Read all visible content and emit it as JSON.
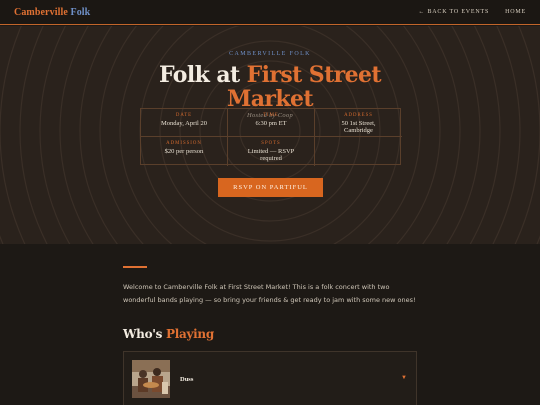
{
  "nav": {
    "brand_part1": "Camberville",
    "brand_part2": "Folk",
    "back_label": "← BACK TO EVENTS",
    "home_label": "HOME"
  },
  "hero": {
    "eyebrow": "CAMBERVILLE FOLK",
    "title_part1": "Folk at",
    "title_part2": "First Street",
    "title_part3": "Market",
    "hosted_by": "Hosted by Coop"
  },
  "details": [
    {
      "label": "DATE",
      "value": "Monday, April 20"
    },
    {
      "label": "TIME",
      "value": "6:30 pm ET"
    },
    {
      "label": "ADDRESS",
      "value": "50 1st Street, Cambridge"
    },
    {
      "label": "ADMISSION",
      "value": "$20 per person"
    },
    {
      "label": "SPOTS",
      "value": "Limited — RSVP required"
    }
  ],
  "rsvp_label": "RSVP ON PARTIFUL",
  "intro_text": "Welcome to Camberville Folk at First Street Market! This is a folk concert with two wonderful bands playing — so bring your friends & get ready to jam with some new ones!",
  "lineup": {
    "title_part1": "Who's",
    "title_part2": "Playing",
    "bands": [
      {
        "name": "Duss",
        "expand_icon": "caret-down-icon"
      }
    ]
  },
  "colors": {
    "accent": "#e07133",
    "brand_blue": "#6f90c8",
    "background": "#1d1915",
    "hero_background": "#2a221c"
  }
}
